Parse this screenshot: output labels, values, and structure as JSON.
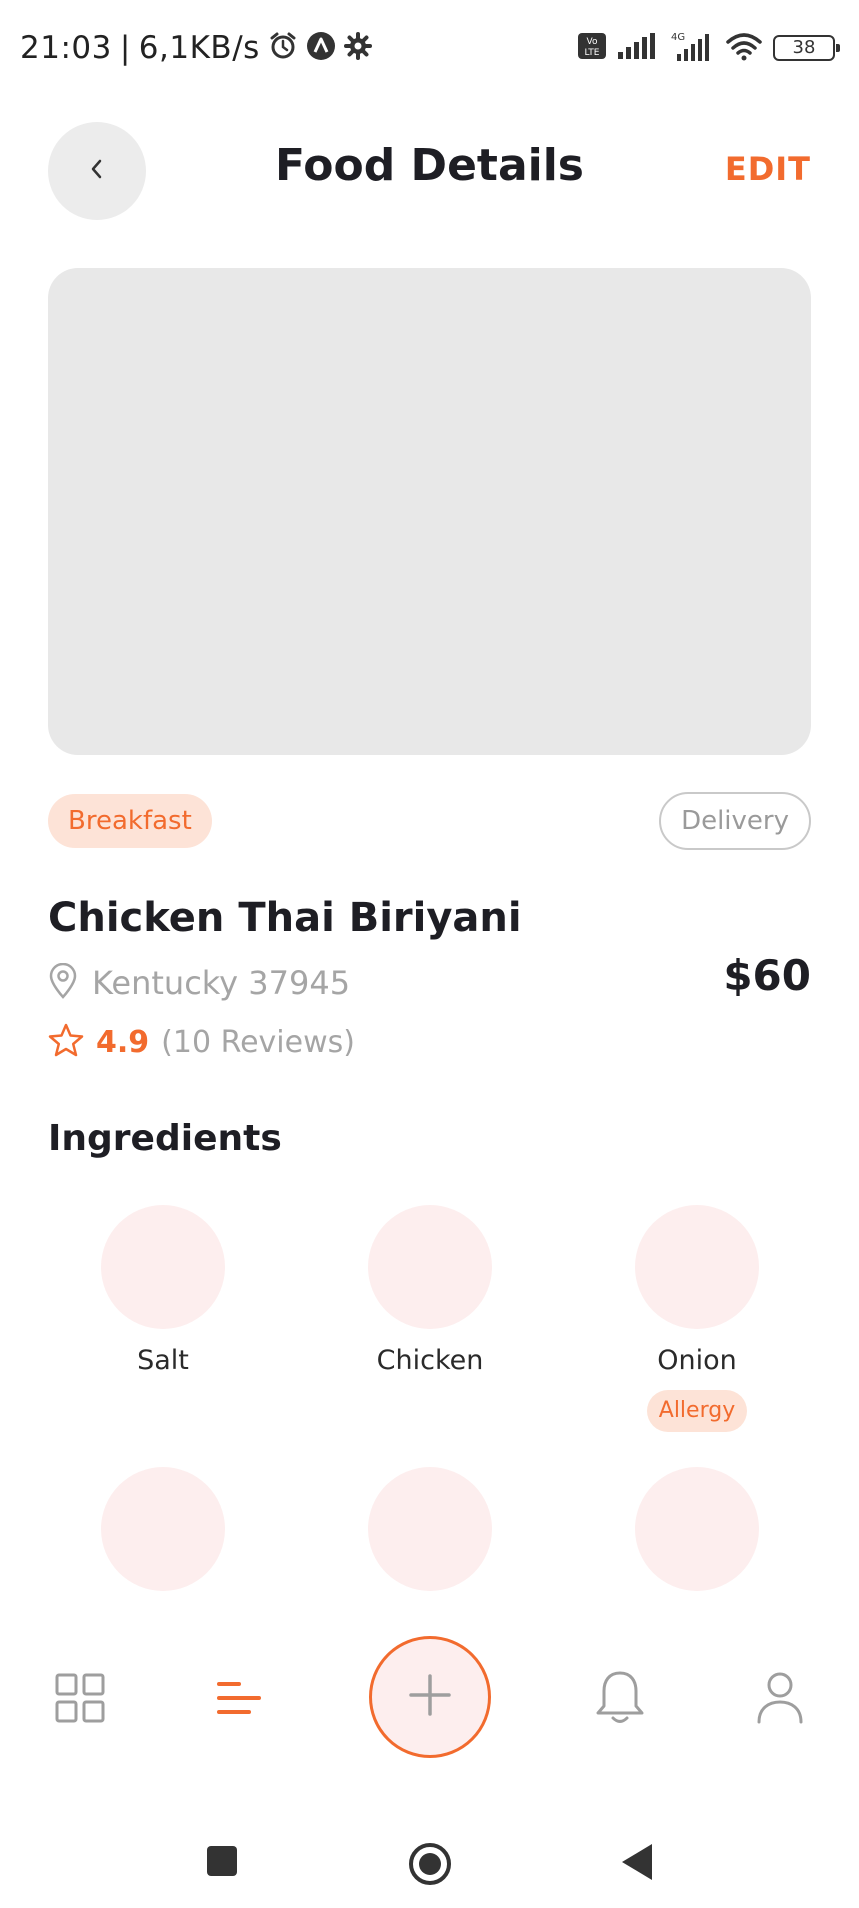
{
  "status_bar": {
    "time": "21:03",
    "separator": "|",
    "network_speed": "6,1KB/s",
    "volte": "Vo LTE",
    "network_type": "4G",
    "battery": "38"
  },
  "header": {
    "back_icon": "chevron-left-icon",
    "title": "Food Details",
    "edit_label": "EDIT"
  },
  "food": {
    "category": "Breakfast",
    "delivery_label": "Delivery",
    "name": "Chicken Thai Biriyani",
    "location": "Kentucky 37945",
    "rating": "4.9",
    "reviews": "(10 Reviews)",
    "price": "$60"
  },
  "ingredients": {
    "title": "Ingredients",
    "items": [
      {
        "label": "Salt"
      },
      {
        "label": "Chicken"
      },
      {
        "label": "Onion",
        "badge": "Allergy"
      },
      {
        "label": ""
      },
      {
        "label": ""
      },
      {
        "label": ""
      }
    ]
  },
  "bottom_nav": {
    "items": [
      "grid-icon",
      "list-icon",
      "plus-icon",
      "bell-icon",
      "user-icon"
    ],
    "active": "list-icon"
  },
  "colors": {
    "accent": "#f26b2e",
    "accent_soft": "#fde3d7",
    "placeholder": "#e8e8e8",
    "ingredient_bg": "#fdeeee",
    "muted_text": "#a5a5a5"
  }
}
